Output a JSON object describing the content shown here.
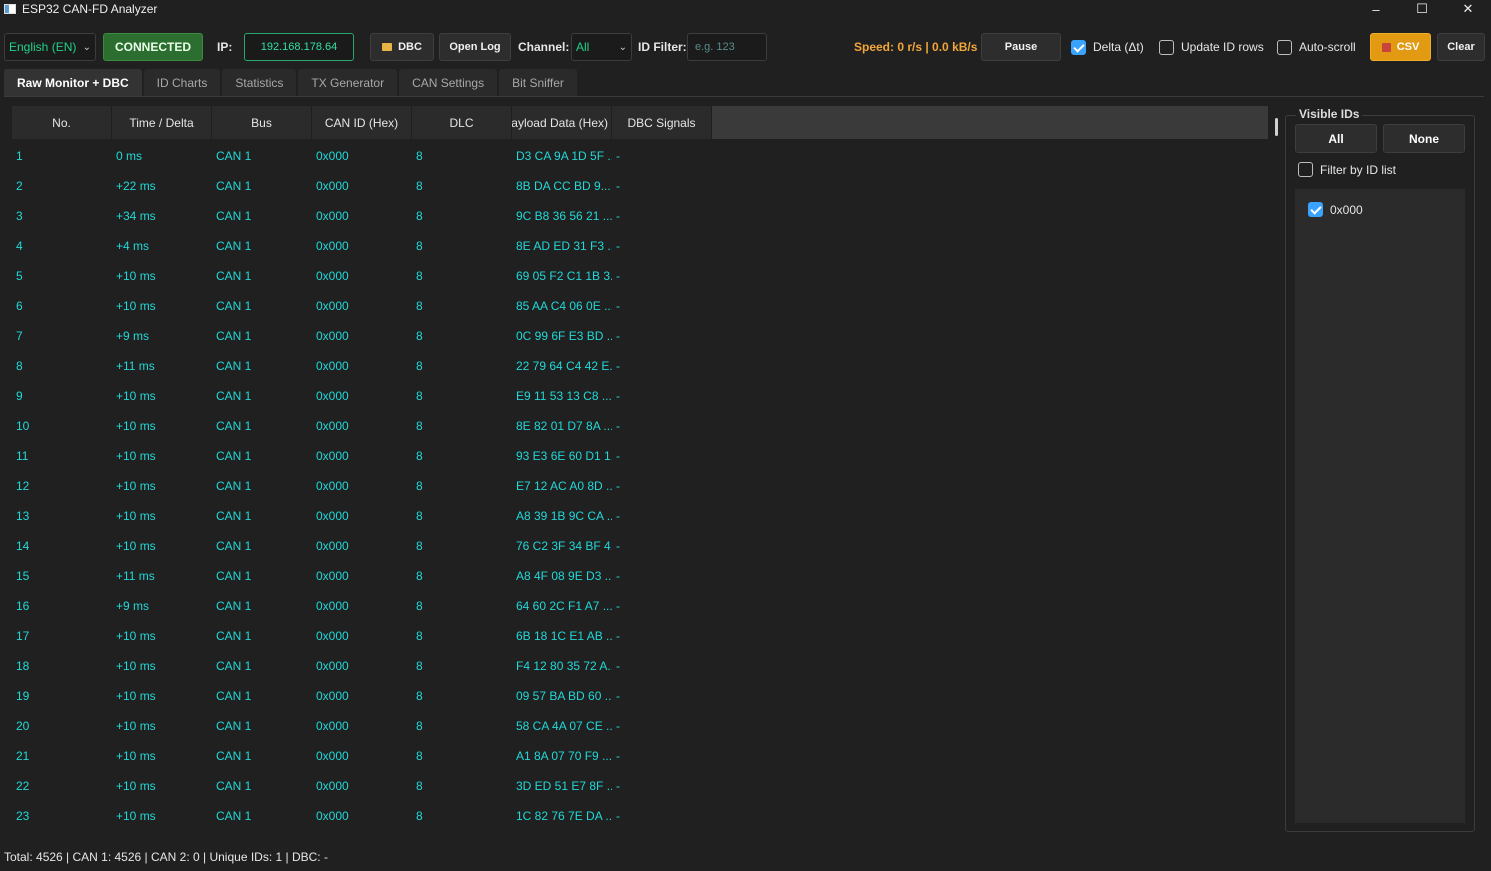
{
  "window": {
    "title": "ESP32 CAN-FD Analyzer",
    "controls": [
      "–",
      "☐",
      "✕"
    ]
  },
  "toolbar": {
    "language": "English (EN)",
    "status": "CONNECTED",
    "ip_label": "IP:",
    "ip_value": "192.168.178.64",
    "dbc_label": "DBC",
    "open_log_label": "Open Log",
    "channel_label": "Channel:",
    "channel_value": "All",
    "id_filter_label": "ID Filter:",
    "id_filter_placeholder": "e.g. 123",
    "speed": "Speed: 0 r/s | 0.0 kB/s",
    "pause_label": "Pause",
    "delta_label": "Delta (Δt)",
    "delta_checked": true,
    "update_rows_label": "Update ID rows",
    "update_rows_checked": false,
    "autoscroll_label": "Auto-scroll",
    "autoscroll_checked": false,
    "csv_label": "CSV",
    "clear_label": "Clear",
    "accent_colors": {
      "connected": "#2c6e2f",
      "csv": "#e29a12",
      "speed": "#f0a63a",
      "data": "#22d8d8"
    }
  },
  "tabs": [
    "Raw Monitor + DBC",
    "ID Charts",
    "Statistics",
    "TX Generator",
    "CAN Settings",
    "Bit Sniffer"
  ],
  "active_tab": "Raw Monitor + DBC",
  "table": {
    "columns": [
      "No.",
      "Time / Delta",
      "Bus",
      "CAN ID (Hex)",
      "DLC",
      "Payload Data (Hex)",
      "DBC Signals"
    ],
    "rows": [
      [
        "1",
        "0 ms",
        "CAN 1",
        "0x000",
        "8",
        "D3 CA 9A 1D 5F ...",
        "-"
      ],
      [
        "2",
        "+22 ms",
        "CAN 1",
        "0x000",
        "8",
        "8B DA CC BD 9...",
        "-"
      ],
      [
        "3",
        "+34 ms",
        "CAN 1",
        "0x000",
        "8",
        "9C B8 36 56 21 ...",
        "-"
      ],
      [
        "4",
        "+4 ms",
        "CAN 1",
        "0x000",
        "8",
        "8E AD ED 31 F3 ...",
        "-"
      ],
      [
        "5",
        "+10 ms",
        "CAN 1",
        "0x000",
        "8",
        "69 05 F2 C1 1B 3...",
        "-"
      ],
      [
        "6",
        "+10 ms",
        "CAN 1",
        "0x000",
        "8",
        "85 AA C4 06 0E ...",
        "-"
      ],
      [
        "7",
        "+9 ms",
        "CAN 1",
        "0x000",
        "8",
        "0C 99 6F E3 BD ...",
        "-"
      ],
      [
        "8",
        "+11 ms",
        "CAN 1",
        "0x000",
        "8",
        "22 79 64 C4 42 E...",
        "-"
      ],
      [
        "9",
        "+10 ms",
        "CAN 1",
        "0x000",
        "8",
        "E9 11 53 13 C8 ...",
        "-"
      ],
      [
        "10",
        "+10 ms",
        "CAN 1",
        "0x000",
        "8",
        "8E 82 01 D7 8A ...",
        "-"
      ],
      [
        "11",
        "+10 ms",
        "CAN 1",
        "0x000",
        "8",
        "93 E3 6E 60 D1 1...",
        "-"
      ],
      [
        "12",
        "+10 ms",
        "CAN 1",
        "0x000",
        "8",
        "E7 12 AC A0 8D ...",
        "-"
      ],
      [
        "13",
        "+10 ms",
        "CAN 1",
        "0x000",
        "8",
        "A8 39 1B 9C CA ...",
        "-"
      ],
      [
        "14",
        "+10 ms",
        "CAN 1",
        "0x000",
        "8",
        "76 C2 3F 34 BF 4...",
        "-"
      ],
      [
        "15",
        "+11 ms",
        "CAN 1",
        "0x000",
        "8",
        "A8 4F 08 9E D3 ...",
        "-"
      ],
      [
        "16",
        "+9 ms",
        "CAN 1",
        "0x000",
        "8",
        "64 60 2C F1 A7 ...",
        "-"
      ],
      [
        "17",
        "+10 ms",
        "CAN 1",
        "0x000",
        "8",
        "6B 18 1C E1 AB ...",
        "-"
      ],
      [
        "18",
        "+10 ms",
        "CAN 1",
        "0x000",
        "8",
        "F4 12 80 35 72 A...",
        "-"
      ],
      [
        "19",
        "+10 ms",
        "CAN 1",
        "0x000",
        "8",
        "09 57 BA BD 60 ...",
        "-"
      ],
      [
        "20",
        "+10 ms",
        "CAN 1",
        "0x000",
        "8",
        "58 CA 4A 07 CE ...",
        "-"
      ],
      [
        "21",
        "+10 ms",
        "CAN 1",
        "0x000",
        "8",
        "A1 8A 07 70 F9 ...",
        "-"
      ],
      [
        "22",
        "+10 ms",
        "CAN 1",
        "0x000",
        "8",
        "3D ED 51 E7 8F ...",
        "-"
      ],
      [
        "23",
        "+10 ms",
        "CAN 1",
        "0x000",
        "8",
        "1C 82 76 7E DA ...",
        "-"
      ]
    ]
  },
  "visible_ids": {
    "title": "Visible IDs",
    "all_label": "All",
    "none_label": "None",
    "filter_label": "Filter by ID list",
    "filter_checked": false,
    "ids": [
      {
        "id": "0x000",
        "checked": true
      }
    ]
  },
  "status_bar": "Total: 4526 | CAN 1: 4526 | CAN 2: 0 | Unique IDs: 1 | DBC: -"
}
